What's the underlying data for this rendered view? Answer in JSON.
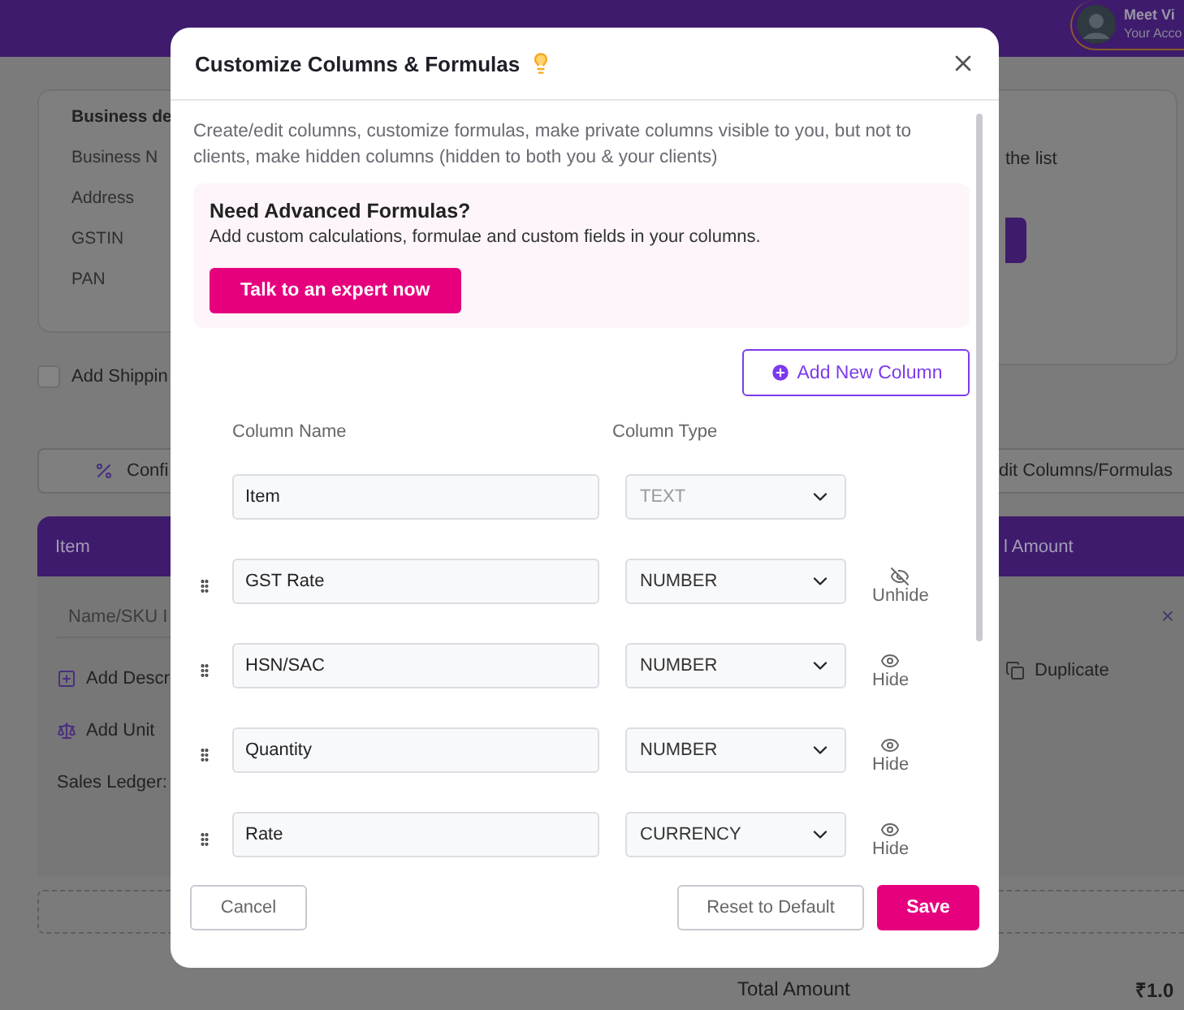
{
  "background": {
    "header": {
      "user_name": "Meet Vi",
      "user_subtitle": "Your Acco"
    },
    "business_card": {
      "title": "Business de",
      "fields": [
        "Business N",
        "Address",
        "GSTIN",
        "PAN"
      ]
    },
    "right_note": "the list",
    "shipping_checkbox": {
      "label": "Add Shippin",
      "checked": false
    },
    "config_button": "Confi",
    "edit_columns_button": "dit Columns/Formulas",
    "table": {
      "columns": [
        "Item",
        "l Amount"
      ],
      "item_placeholder": "Name/SKU I",
      "add_description": "Add Descr",
      "add_unit": "Add Unit",
      "duplicate": "Duplicate",
      "sales_ledger": "Sales Ledger:",
      "remove": "×"
    },
    "total": {
      "label": "Total Amount",
      "value": "₹1.0"
    }
  },
  "dialog": {
    "title": "Customize Columns & Formulas",
    "description": "Create/edit columns, customize formulas, make private columns visible to you, but not to clients, make hidden columns (hidden to both you & your clients)",
    "promo": {
      "title": "Need Advanced Formulas?",
      "text": "Add custom calculations, formulae and custom fields in your columns.",
      "button": "Talk to an expert now"
    },
    "add_button": "Add New Column",
    "headers": [
      "Column Name",
      "Column Type"
    ],
    "columns": [
      {
        "name": "Item",
        "type": "TEXT",
        "disabled": true
      },
      {
        "name": "GST Rate",
        "type": "NUMBER",
        "disabled": false,
        "draggable": true,
        "hidden": true,
        "action": "Unhide"
      },
      {
        "name": "HSN/SAC",
        "type": "NUMBER",
        "disabled": false,
        "draggable": true,
        "hidden": false,
        "action": "Hide"
      },
      {
        "name": "Quantity",
        "type": "NUMBER",
        "disabled": false,
        "draggable": true,
        "hidden": false,
        "action": "Hide"
      },
      {
        "name": "Rate",
        "type": "CURRENCY",
        "disabled": false,
        "draggable": true,
        "hidden": false,
        "action": "Hide"
      }
    ],
    "buttons": {
      "cancel": "Cancel",
      "reset": "Reset to Default",
      "save": "Save"
    }
  }
}
